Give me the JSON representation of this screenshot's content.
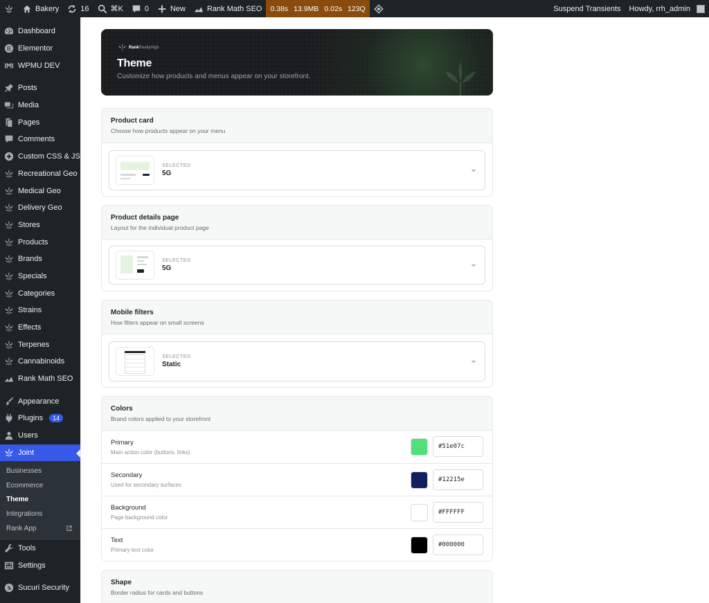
{
  "adminbar": {
    "site": "Bakery",
    "updates": "16",
    "shortcut": "⌘K",
    "comments": "0",
    "new_label": "New",
    "seo": "Rank Math SEO",
    "perf": [
      "0.38s",
      "13.9MB",
      "0.02s",
      "123Q"
    ],
    "suspend": "Suspend Transients",
    "howdy": "Howdy, rrh_admin"
  },
  "sidebar": {
    "items": [
      {
        "label": "Dashboard",
        "icon": "dashboard-icon"
      },
      {
        "label": "Elementor",
        "icon": "elementor-icon"
      },
      {
        "label": "WPMU DEV",
        "icon": "wpmudev-icon"
      },
      {
        "label": "Posts",
        "icon": "pin-icon"
      },
      {
        "label": "Media",
        "icon": "media-icon"
      },
      {
        "label": "Pages",
        "icon": "page-icon"
      },
      {
        "label": "Comments",
        "icon": "comment-icon"
      },
      {
        "label": "Custom CSS & JS",
        "icon": "plus-circle-icon"
      },
      {
        "label": "Recreational Geo",
        "icon": "leaf-icon"
      },
      {
        "label": "Medical Geo",
        "icon": "leaf-icon"
      },
      {
        "label": "Delivery Geo",
        "icon": "leaf-icon"
      },
      {
        "label": "Stores",
        "icon": "leaf-icon"
      },
      {
        "label": "Products",
        "icon": "leaf-icon"
      },
      {
        "label": "Brands",
        "icon": "leaf-icon"
      },
      {
        "label": "Specials",
        "icon": "leaf-icon"
      },
      {
        "label": "Categories",
        "icon": "leaf-icon"
      },
      {
        "label": "Strains",
        "icon": "leaf-icon"
      },
      {
        "label": "Effects",
        "icon": "leaf-icon"
      },
      {
        "label": "Terpenes",
        "icon": "leaf-icon"
      },
      {
        "label": "Cannabinoids",
        "icon": "leaf-icon"
      },
      {
        "label": "Rank Math SEO",
        "icon": "rankmath-icon"
      },
      {
        "label": "Appearance",
        "icon": "brush-icon"
      },
      {
        "label": "Plugins",
        "icon": "plugin-icon",
        "badge": "14"
      },
      {
        "label": "Users",
        "icon": "user-icon"
      },
      {
        "label": "Joint",
        "icon": "leaf-icon"
      },
      {
        "label": "Tools",
        "icon": "wrench-icon"
      },
      {
        "label": "Settings",
        "icon": "settings-icon"
      },
      {
        "label": "Sucuri Security",
        "icon": "sucuri-icon"
      }
    ],
    "submenu": [
      "Businesses",
      "Ecommerce",
      "Theme",
      "Integrations",
      "Rank App"
    ]
  },
  "hero": {
    "logo_a": "Rank",
    "logo_b": "ReallyHigh",
    "title": "Theme",
    "subtitle": "Customize how products and menus appear on your storefront."
  },
  "cards": {
    "product_card": {
      "title": "Product card",
      "desc": "Choose how products appear on your menu",
      "label": "SELECTED",
      "value": "5G"
    },
    "product_details": {
      "title": "Product details page",
      "desc": "Layout for the individual product page",
      "label": "SELECTED",
      "value": "5G"
    },
    "mobile_filters": {
      "title": "Mobile filters",
      "desc": "How filters appear on small screens",
      "label": "SELECTED",
      "value": "Static"
    }
  },
  "colors": {
    "title": "Colors",
    "desc": "Brand colors applied to your storefront",
    "rows": [
      {
        "name": "Primary",
        "help": "Main action color (buttons, links)",
        "hex": "#51e07c"
      },
      {
        "name": "Secondary",
        "help": "Used for secondary surfaces",
        "hex": "#12215e"
      },
      {
        "name": "Background",
        "help": "Page background color",
        "hex": "#FFFFFF"
      },
      {
        "name": "Text",
        "help": "Primary text color",
        "hex": "#000000"
      }
    ]
  },
  "shape": {
    "title": "Shape",
    "desc": "Border radius for cards and buttons"
  },
  "accent": "#3858e9"
}
